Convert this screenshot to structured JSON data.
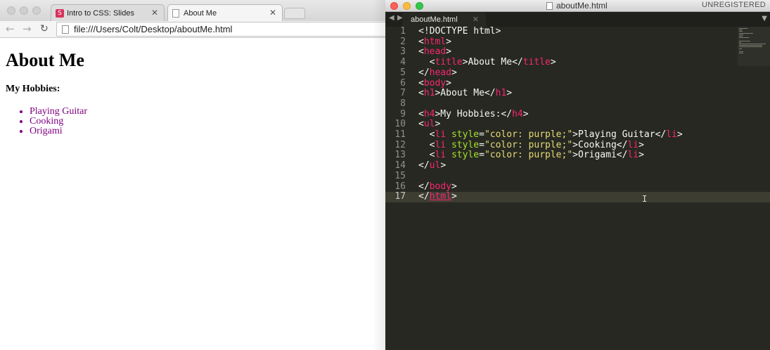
{
  "browser": {
    "tabs": [
      {
        "label": "Intro to CSS: Slides",
        "favicon": "S",
        "active": false
      },
      {
        "label": "About Me",
        "active": true
      }
    ],
    "address": "file:///Users/Colt/Desktop/aboutMe.html",
    "page": {
      "heading": "About Me",
      "subheading": "My Hobbies:",
      "hobbies": [
        "Playing Guitar",
        "Cooking",
        "Origami"
      ],
      "hobby_color": "#800080"
    }
  },
  "editor": {
    "window_title": "aboutMe.html",
    "license": "UNREGISTERED",
    "tab": "aboutMe.html",
    "current_line": 17,
    "code_lines": [
      "<!DOCTYPE html>",
      "<html>",
      "<head>",
      "  <title>About Me</title>",
      "</head>",
      "<body>",
      "<h1>About Me</h1>",
      "",
      "<h4>My Hobbies:</h4>",
      "<ul>",
      "  <li style=\"color: purple;\">Playing Guitar</li>",
      "  <li style=\"color: purple;\">Cooking</li>",
      "  <li style=\"color: purple;\">Origami</li>",
      "</ul>",
      "",
      "</body>",
      "</html>"
    ],
    "theme": {
      "tag": "#f92672",
      "attr": "#a6e22e",
      "string": "#e6db74",
      "text": "#f8f8f2",
      "bg": "#272822"
    }
  },
  "icons": [
    "back-arrow-icon",
    "forward-arrow-icon",
    "reload-icon",
    "page-icon",
    "tab-close-icon",
    "traffic-light-close",
    "traffic-light-minimize",
    "traffic-light-zoom",
    "text-cursor-icon"
  ]
}
